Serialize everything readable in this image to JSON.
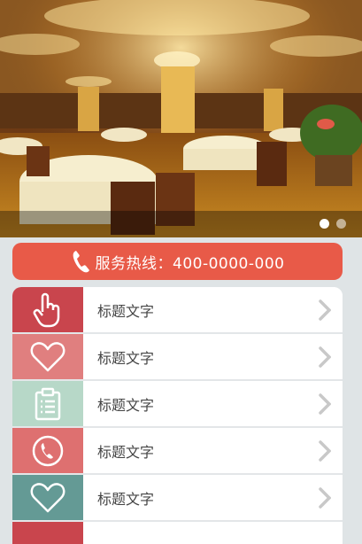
{
  "banner": {
    "image": "restaurant-dining-hall",
    "slides": 2,
    "active_slide": 1
  },
  "hotline": {
    "label": "服务热线：400-0000-000",
    "icon": "phone-icon",
    "color": "#e85a48"
  },
  "menu": {
    "items": [
      {
        "label": "标题文字",
        "icon": "hand-pointer-icon",
        "color": "#c9454d"
      },
      {
        "label": "标题文字",
        "icon": "heart-icon",
        "color": "#e07f7f"
      },
      {
        "label": "标题文字",
        "icon": "clipboard-icon",
        "color": "#b7d8c8"
      },
      {
        "label": "标题文字",
        "icon": "phone-circle-icon",
        "color": "#de7070"
      },
      {
        "label": "标题文字",
        "icon": "heart-icon",
        "color": "#649a95"
      },
      {
        "label": "",
        "icon": "",
        "color": "#c9454d"
      }
    ]
  }
}
